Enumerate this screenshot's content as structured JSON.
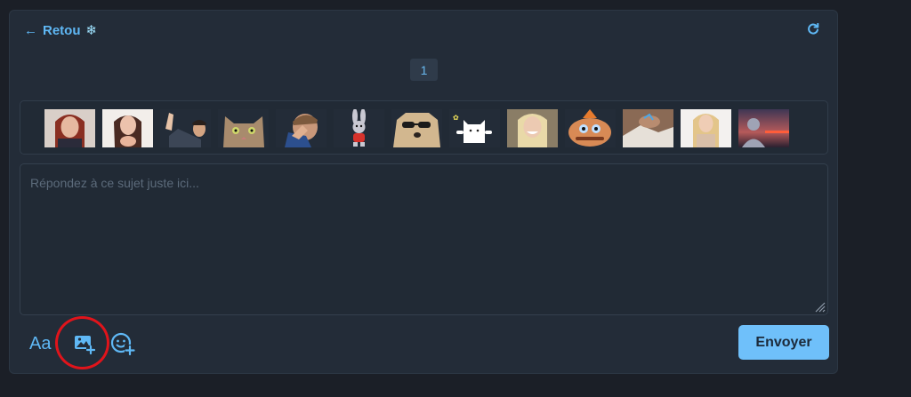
{
  "header": {
    "back_label": "Retou",
    "back_emoji": "❄"
  },
  "pagination": {
    "current_page": "1"
  },
  "stickers": [
    {
      "name": "sticker-girl-redhair"
    },
    {
      "name": "sticker-girl-heart-hands"
    },
    {
      "name": "sticker-man-waving"
    },
    {
      "name": "sticker-cat"
    },
    {
      "name": "sticker-boy-facepalm"
    },
    {
      "name": "sticker-cartoon-bunny"
    },
    {
      "name": "sticker-dog-sunglasses"
    },
    {
      "name": "sticker-white-cat-cartoon"
    },
    {
      "name": "sticker-woman-laughing"
    },
    {
      "name": "sticker-cartoon-face"
    },
    {
      "name": "sticker-hands-blanket"
    },
    {
      "name": "sticker-woman-blonde"
    },
    {
      "name": "sticker-sunset-silhouette"
    }
  ],
  "reply": {
    "placeholder": "Répondez à ce sujet juste ici..."
  },
  "toolbar": {
    "text_format_label": "Aa",
    "send_label": "Envoyer"
  },
  "colors": {
    "accent": "#6fc0fa",
    "panel": "#232c38",
    "highlight": "#e0141b"
  },
  "icons": [
    "arrow-left-icon",
    "snowflake-icon",
    "refresh-icon",
    "image-add-icon",
    "emoji-add-icon",
    "resize-grip-icon"
  ]
}
